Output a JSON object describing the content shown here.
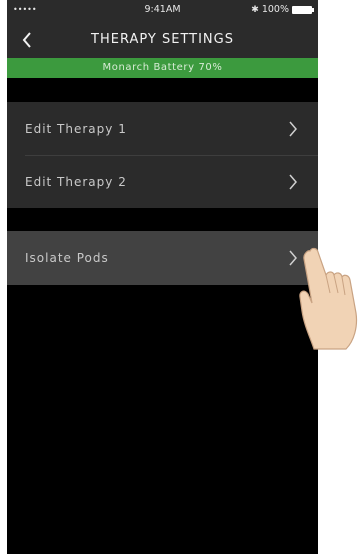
{
  "status_bar": {
    "signal": "•••••",
    "time": "9:41AM",
    "bluetooth": "✱",
    "battery_percent": "100%"
  },
  "nav": {
    "title": "THERAPY SETTINGS",
    "back_icon": "chevron-left-icon"
  },
  "battery_banner": {
    "text": "Monarch Battery 70%",
    "color": "#3c9a3e"
  },
  "menu": {
    "group1": [
      {
        "label": "Edit Therapy 1"
      },
      {
        "label": "Edit Therapy 2"
      }
    ],
    "group2": [
      {
        "label": "Isolate Pods"
      }
    ]
  },
  "colors": {
    "background": "#000000",
    "bar": "#2b2b2b",
    "row_highlight": "#424242",
    "text": "#c9c9c9"
  }
}
